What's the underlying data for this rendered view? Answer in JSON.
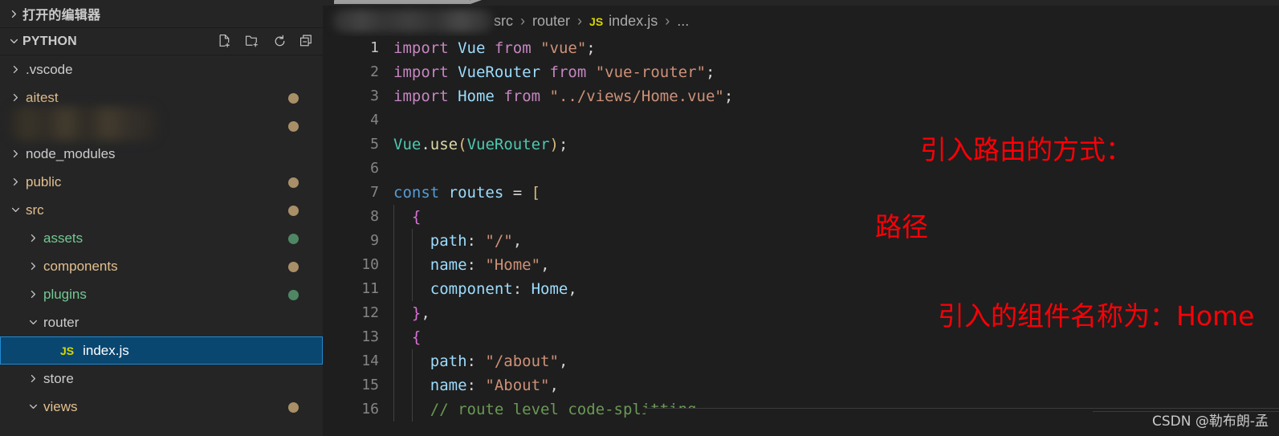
{
  "sidebar": {
    "open_editors": {
      "label": "打开的编辑器",
      "expanded": false
    },
    "explorer": {
      "label": "PYTHON",
      "expanded": true,
      "actions": [
        {
          "name": "new-file-icon",
          "tooltip": "新建文件"
        },
        {
          "name": "new-folder-icon",
          "tooltip": "新建文件夹"
        },
        {
          "name": "refresh-icon",
          "tooltip": "刷新资源管理器"
        },
        {
          "name": "collapse-all-icon",
          "tooltip": "在资源管理器中折叠文件夹"
        }
      ]
    },
    "tree": [
      {
        "label": ".vscode",
        "type": "folder",
        "expanded": false,
        "depth": 1,
        "color": "#cccccc",
        "dot": null,
        "blurred": false
      },
      {
        "label": "aitest",
        "type": "folder",
        "expanded": false,
        "depth": 1,
        "color": "#e2c08d",
        "dot": "#a98f67",
        "blurred": false
      },
      {
        "label": "",
        "type": "folder",
        "expanded": false,
        "depth": 1,
        "color": "#e2c08d",
        "dot": "#a98f67",
        "blurred": true
      },
      {
        "label": "node_modules",
        "type": "folder",
        "expanded": false,
        "depth": 1,
        "color": "#cccccc",
        "dot": null,
        "blurred": false
      },
      {
        "label": "public",
        "type": "folder",
        "expanded": false,
        "depth": 1,
        "color": "#e2c08d",
        "dot": "#a98f67",
        "blurred": false
      },
      {
        "label": "src",
        "type": "folder",
        "expanded": true,
        "depth": 1,
        "color": "#e2c08d",
        "dot": "#a98f67",
        "blurred": false
      },
      {
        "label": "assets",
        "type": "folder",
        "expanded": false,
        "depth": 2,
        "color": "#73c991",
        "dot": "#4f8765",
        "blurred": false
      },
      {
        "label": "components",
        "type": "folder",
        "expanded": false,
        "depth": 2,
        "color": "#e2c08d",
        "dot": "#a98f67",
        "blurred": false
      },
      {
        "label": "plugins",
        "type": "folder",
        "expanded": false,
        "depth": 2,
        "color": "#73c991",
        "dot": "#4f8765",
        "blurred": false
      },
      {
        "label": "router",
        "type": "folder",
        "expanded": true,
        "depth": 2,
        "color": "#cccccc",
        "dot": null,
        "blurred": false
      },
      {
        "label": "index.js",
        "type": "file",
        "expanded": null,
        "depth": 3,
        "color": "#ffffff",
        "dot": null,
        "blurred": false,
        "badge": "JS",
        "selected": true
      },
      {
        "label": "store",
        "type": "folder",
        "expanded": false,
        "depth": 2,
        "color": "#cccccc",
        "dot": null,
        "blurred": false
      },
      {
        "label": "views",
        "type": "folder",
        "expanded": true,
        "depth": 2,
        "color": "#e2c08d",
        "dot": "#a98f67",
        "blurred": false
      }
    ]
  },
  "breadcrumb": {
    "redacted": true,
    "items": [
      {
        "label": "src",
        "badge": null
      },
      {
        "label": "router",
        "badge": null
      },
      {
        "label": "index.js",
        "badge": "JS"
      },
      {
        "label": "...",
        "badge": null
      }
    ],
    "separator": "›"
  },
  "editor": {
    "active_line": 1,
    "lines": [
      {
        "n": "1",
        "tokens": [
          {
            "t": "import",
            "c": "t-kw"
          },
          {
            "t": " ",
            "c": "t-plain"
          },
          {
            "t": "Vue",
            "c": "t-var"
          },
          {
            "t": " ",
            "c": "t-plain"
          },
          {
            "t": "from",
            "c": "t-kw"
          },
          {
            "t": " ",
            "c": "t-plain"
          },
          {
            "t": "\"vue\"",
            "c": "t-str"
          },
          {
            "t": ";",
            "c": "t-plain"
          }
        ]
      },
      {
        "n": "2",
        "tokens": [
          {
            "t": "import",
            "c": "t-kw"
          },
          {
            "t": " ",
            "c": "t-plain"
          },
          {
            "t": "VueRouter",
            "c": "t-var"
          },
          {
            "t": " ",
            "c": "t-plain"
          },
          {
            "t": "from",
            "c": "t-kw"
          },
          {
            "t": " ",
            "c": "t-plain"
          },
          {
            "t": "\"vue-router\"",
            "c": "t-str"
          },
          {
            "t": ";",
            "c": "t-plain"
          }
        ]
      },
      {
        "n": "3",
        "tokens": [
          {
            "t": "import",
            "c": "t-kw"
          },
          {
            "t": " ",
            "c": "t-plain"
          },
          {
            "t": "Home",
            "c": "t-var"
          },
          {
            "t": " ",
            "c": "t-plain"
          },
          {
            "t": "from",
            "c": "t-kw"
          },
          {
            "t": " ",
            "c": "t-plain"
          },
          {
            "t": "\"../views/Home.vue\"",
            "c": "t-str"
          },
          {
            "t": ";",
            "c": "t-plain"
          }
        ]
      },
      {
        "n": "4",
        "tokens": []
      },
      {
        "n": "5",
        "tokens": [
          {
            "t": "Vue",
            "c": "t-cls"
          },
          {
            "t": ".",
            "c": "t-plain"
          },
          {
            "t": "use",
            "c": "t-fn"
          },
          {
            "t": "(",
            "c": "t-br1"
          },
          {
            "t": "VueRouter",
            "c": "t-cls"
          },
          {
            "t": ")",
            "c": "t-br1"
          },
          {
            "t": ";",
            "c": "t-plain"
          }
        ]
      },
      {
        "n": "6",
        "tokens": []
      },
      {
        "n": "7",
        "tokens": [
          {
            "t": "const",
            "c": "t-kw2"
          },
          {
            "t": " ",
            "c": "t-plain"
          },
          {
            "t": "routes",
            "c": "t-var"
          },
          {
            "t": " ",
            "c": "t-plain"
          },
          {
            "t": "=",
            "c": "t-plain"
          },
          {
            "t": " ",
            "c": "t-plain"
          },
          {
            "t": "[",
            "c": "t-br1"
          }
        ]
      },
      {
        "n": "8",
        "tokens": [
          {
            "t": "  ",
            "c": "t-plain"
          },
          {
            "t": "{",
            "c": "t-br2"
          }
        ]
      },
      {
        "n": "9",
        "tokens": [
          {
            "t": "    ",
            "c": "t-plain"
          },
          {
            "t": "path",
            "c": "t-var"
          },
          {
            "t": ": ",
            "c": "t-plain"
          },
          {
            "t": "\"/\"",
            "c": "t-str"
          },
          {
            "t": ",",
            "c": "t-plain"
          }
        ]
      },
      {
        "n": "10",
        "tokens": [
          {
            "t": "    ",
            "c": "t-plain"
          },
          {
            "t": "name",
            "c": "t-var"
          },
          {
            "t": ": ",
            "c": "t-plain"
          },
          {
            "t": "\"Home\"",
            "c": "t-str"
          },
          {
            "t": ",",
            "c": "t-plain"
          }
        ]
      },
      {
        "n": "11",
        "tokens": [
          {
            "t": "    ",
            "c": "t-plain"
          },
          {
            "t": "component",
            "c": "t-var"
          },
          {
            "t": ": ",
            "c": "t-plain"
          },
          {
            "t": "Home",
            "c": "t-var"
          },
          {
            "t": ",",
            "c": "t-plain"
          }
        ]
      },
      {
        "n": "12",
        "tokens": [
          {
            "t": "  ",
            "c": "t-plain"
          },
          {
            "t": "}",
            "c": "t-br2"
          },
          {
            "t": ",",
            "c": "t-plain"
          }
        ]
      },
      {
        "n": "13",
        "tokens": [
          {
            "t": "  ",
            "c": "t-plain"
          },
          {
            "t": "{",
            "c": "t-br2"
          }
        ]
      },
      {
        "n": "14",
        "tokens": [
          {
            "t": "    ",
            "c": "t-plain"
          },
          {
            "t": "path",
            "c": "t-var"
          },
          {
            "t": ": ",
            "c": "t-plain"
          },
          {
            "t": "\"/about\"",
            "c": "t-str"
          },
          {
            "t": ",",
            "c": "t-plain"
          }
        ]
      },
      {
        "n": "15",
        "tokens": [
          {
            "t": "    ",
            "c": "t-plain"
          },
          {
            "t": "name",
            "c": "t-var"
          },
          {
            "t": ": ",
            "c": "t-plain"
          },
          {
            "t": "\"About\"",
            "c": "t-str"
          },
          {
            "t": ",",
            "c": "t-plain"
          }
        ]
      },
      {
        "n": "16",
        "tokens": [
          {
            "t": "    ",
            "c": "t-plain"
          },
          {
            "t": "// route level code-splitting",
            "c": "t-cmt"
          }
        ]
      }
    ]
  },
  "annotations": [
    {
      "id": "annot1",
      "text": "引入路由的方式：",
      "color": "#fb0007"
    },
    {
      "id": "annot3",
      "text": "路径",
      "color": "#fb0007"
    },
    {
      "id": "annot2",
      "text": "引入的组件名称为：Home",
      "color": "#fb0007"
    }
  ],
  "watermark": {
    "text": "CSDN @勒布朗-孟"
  }
}
